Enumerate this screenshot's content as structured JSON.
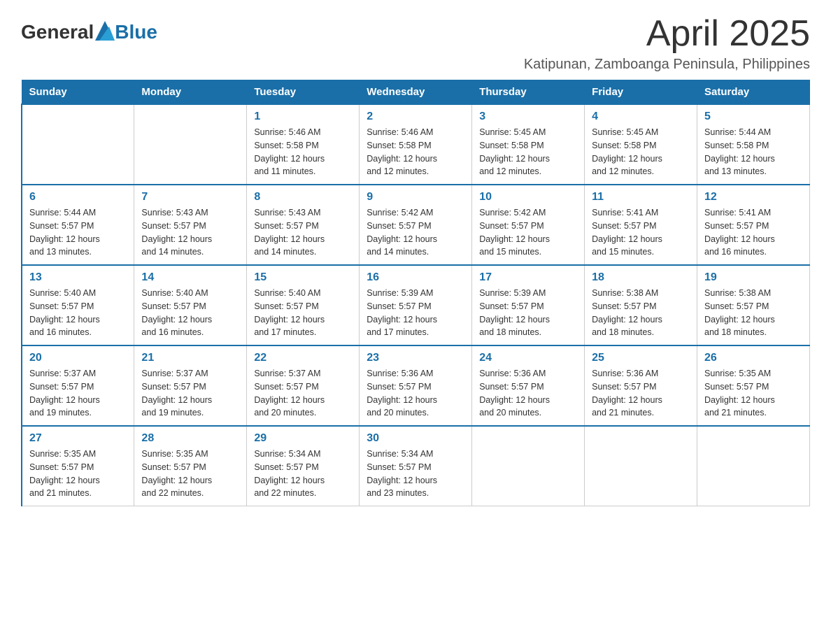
{
  "logo": {
    "general": "General",
    "blue": "Blue"
  },
  "title": "April 2025",
  "location": "Katipunan, Zamboanga Peninsula, Philippines",
  "days_of_week": [
    "Sunday",
    "Monday",
    "Tuesday",
    "Wednesday",
    "Thursday",
    "Friday",
    "Saturday"
  ],
  "weeks": [
    [
      {
        "day": "",
        "info": ""
      },
      {
        "day": "",
        "info": ""
      },
      {
        "day": "1",
        "info": "Sunrise: 5:46 AM\nSunset: 5:58 PM\nDaylight: 12 hours\nand 11 minutes."
      },
      {
        "day": "2",
        "info": "Sunrise: 5:46 AM\nSunset: 5:58 PM\nDaylight: 12 hours\nand 12 minutes."
      },
      {
        "day": "3",
        "info": "Sunrise: 5:45 AM\nSunset: 5:58 PM\nDaylight: 12 hours\nand 12 minutes."
      },
      {
        "day": "4",
        "info": "Sunrise: 5:45 AM\nSunset: 5:58 PM\nDaylight: 12 hours\nand 12 minutes."
      },
      {
        "day": "5",
        "info": "Sunrise: 5:44 AM\nSunset: 5:58 PM\nDaylight: 12 hours\nand 13 minutes."
      }
    ],
    [
      {
        "day": "6",
        "info": "Sunrise: 5:44 AM\nSunset: 5:57 PM\nDaylight: 12 hours\nand 13 minutes."
      },
      {
        "day": "7",
        "info": "Sunrise: 5:43 AM\nSunset: 5:57 PM\nDaylight: 12 hours\nand 14 minutes."
      },
      {
        "day": "8",
        "info": "Sunrise: 5:43 AM\nSunset: 5:57 PM\nDaylight: 12 hours\nand 14 minutes."
      },
      {
        "day": "9",
        "info": "Sunrise: 5:42 AM\nSunset: 5:57 PM\nDaylight: 12 hours\nand 14 minutes."
      },
      {
        "day": "10",
        "info": "Sunrise: 5:42 AM\nSunset: 5:57 PM\nDaylight: 12 hours\nand 15 minutes."
      },
      {
        "day": "11",
        "info": "Sunrise: 5:41 AM\nSunset: 5:57 PM\nDaylight: 12 hours\nand 15 minutes."
      },
      {
        "day": "12",
        "info": "Sunrise: 5:41 AM\nSunset: 5:57 PM\nDaylight: 12 hours\nand 16 minutes."
      }
    ],
    [
      {
        "day": "13",
        "info": "Sunrise: 5:40 AM\nSunset: 5:57 PM\nDaylight: 12 hours\nand 16 minutes."
      },
      {
        "day": "14",
        "info": "Sunrise: 5:40 AM\nSunset: 5:57 PM\nDaylight: 12 hours\nand 16 minutes."
      },
      {
        "day": "15",
        "info": "Sunrise: 5:40 AM\nSunset: 5:57 PM\nDaylight: 12 hours\nand 17 minutes."
      },
      {
        "day": "16",
        "info": "Sunrise: 5:39 AM\nSunset: 5:57 PM\nDaylight: 12 hours\nand 17 minutes."
      },
      {
        "day": "17",
        "info": "Sunrise: 5:39 AM\nSunset: 5:57 PM\nDaylight: 12 hours\nand 18 minutes."
      },
      {
        "day": "18",
        "info": "Sunrise: 5:38 AM\nSunset: 5:57 PM\nDaylight: 12 hours\nand 18 minutes."
      },
      {
        "day": "19",
        "info": "Sunrise: 5:38 AM\nSunset: 5:57 PM\nDaylight: 12 hours\nand 18 minutes."
      }
    ],
    [
      {
        "day": "20",
        "info": "Sunrise: 5:37 AM\nSunset: 5:57 PM\nDaylight: 12 hours\nand 19 minutes."
      },
      {
        "day": "21",
        "info": "Sunrise: 5:37 AM\nSunset: 5:57 PM\nDaylight: 12 hours\nand 19 minutes."
      },
      {
        "day": "22",
        "info": "Sunrise: 5:37 AM\nSunset: 5:57 PM\nDaylight: 12 hours\nand 20 minutes."
      },
      {
        "day": "23",
        "info": "Sunrise: 5:36 AM\nSunset: 5:57 PM\nDaylight: 12 hours\nand 20 minutes."
      },
      {
        "day": "24",
        "info": "Sunrise: 5:36 AM\nSunset: 5:57 PM\nDaylight: 12 hours\nand 20 minutes."
      },
      {
        "day": "25",
        "info": "Sunrise: 5:36 AM\nSunset: 5:57 PM\nDaylight: 12 hours\nand 21 minutes."
      },
      {
        "day": "26",
        "info": "Sunrise: 5:35 AM\nSunset: 5:57 PM\nDaylight: 12 hours\nand 21 minutes."
      }
    ],
    [
      {
        "day": "27",
        "info": "Sunrise: 5:35 AM\nSunset: 5:57 PM\nDaylight: 12 hours\nand 21 minutes."
      },
      {
        "day": "28",
        "info": "Sunrise: 5:35 AM\nSunset: 5:57 PM\nDaylight: 12 hours\nand 22 minutes."
      },
      {
        "day": "29",
        "info": "Sunrise: 5:34 AM\nSunset: 5:57 PM\nDaylight: 12 hours\nand 22 minutes."
      },
      {
        "day": "30",
        "info": "Sunrise: 5:34 AM\nSunset: 5:57 PM\nDaylight: 12 hours\nand 23 minutes."
      },
      {
        "day": "",
        "info": ""
      },
      {
        "day": "",
        "info": ""
      },
      {
        "day": "",
        "info": ""
      }
    ]
  ]
}
